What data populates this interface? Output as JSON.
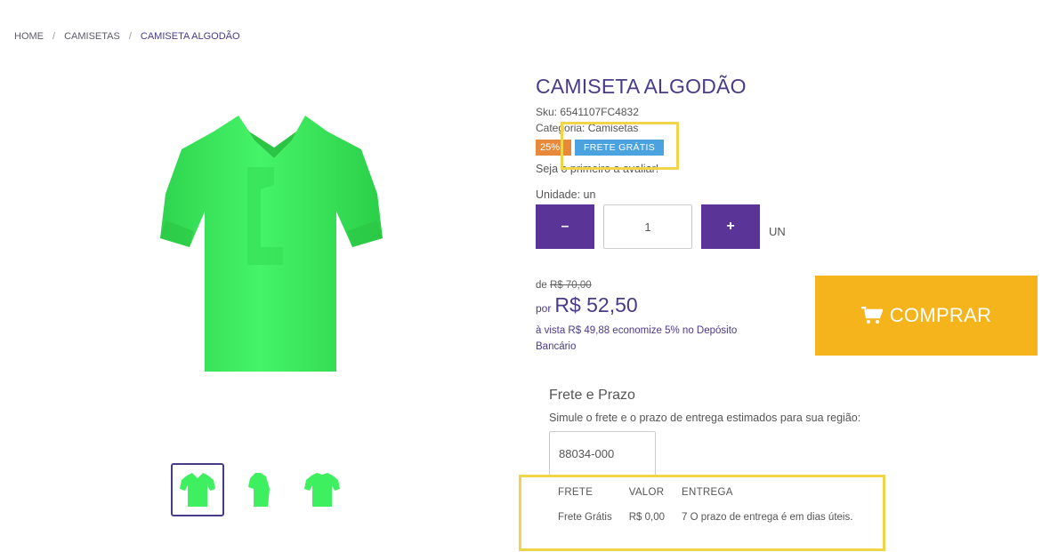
{
  "breadcrumb": {
    "items": [
      "HOME",
      "CAMISETAS"
    ],
    "separator": "/",
    "current": "CAMISETA ALGODÃO"
  },
  "product": {
    "title": "CAMISETA ALGODÃO",
    "sku": "Sku: 6541107FC4832",
    "category": "Categoria: Camisetas",
    "discount_badge": "25%",
    "free_shipping_badge": "FRETE GRÁTIS",
    "review_prompt": "Seja o primeiro a avaliar!",
    "unit_label": "Unidade: un",
    "quantity": "1",
    "quantity_minus": "–",
    "quantity_plus": "+",
    "unit": "UN",
    "old_price_prefix": "de",
    "old_price": "R$ 70,00",
    "price_prefix": "por",
    "price": "R$ 52,50",
    "cash_price_text": "à vista R$ 49,88 economize 5% no Depósito Bancário",
    "buy_label": "COMPRAR",
    "image_color": "#3ef05f"
  },
  "shipping": {
    "title": "Frete e Prazo",
    "subtitle": "Simule o frete e o prazo de entrega estimados para sua região:",
    "cep_value": "88034-000",
    "columns": [
      "FRETE",
      "VALOR",
      "ENTREGA"
    ],
    "rows": [
      {
        "frete": "Frete Grátis",
        "valor": "R$ 0,00",
        "entrega": "7 O prazo de entrega é em dias úteis."
      }
    ]
  },
  "colors": {
    "brand_purple": "#5a3597",
    "title_purple": "#4a3a8a",
    "buy_button": "#f5b31c",
    "discount_badge": "#e8893a",
    "free_shipping_badge": "#4aa3df",
    "highlight": "#f0d44a"
  }
}
